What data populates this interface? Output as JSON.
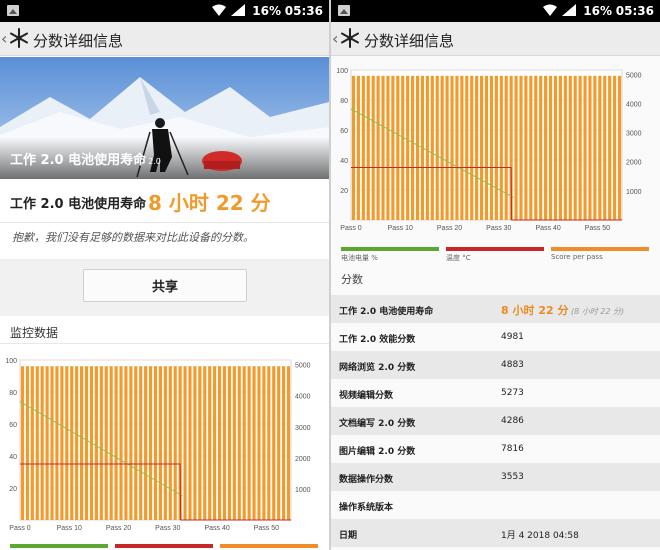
{
  "status": {
    "battery": "16%",
    "time": "05:36"
  },
  "appbar": {
    "title": "分数详细信息",
    "back_icon": "chevron-left-icon",
    "logo_icon": "snowflake-icon"
  },
  "left": {
    "hero_caption": "工作 2.0 电池使用寿命",
    "hero_caption_small": "2.0",
    "score_label": "工作 2.0 电池使用寿命",
    "score_value": "8 小时 22 分",
    "sorry_text": "抱歉，我们没有足够的数据来对比此设备的分数。",
    "share_label": "共享",
    "monitor_label": "监控数据"
  },
  "right": {
    "legend": [
      "电池电量 %",
      "温度 °C",
      "Score per pass"
    ],
    "section_title": "分数",
    "rows": [
      {
        "key": "工作 2.0 电池使用寿命",
        "value": "8 小时 22 分",
        "sub": "(8 小时 22 分)",
        "highlight": true
      },
      {
        "key": "工作 2.0 效能分数",
        "value": "4981"
      },
      {
        "key": "网络浏览 2.0 分数",
        "value": "4883"
      },
      {
        "key": "视频编辑分数",
        "value": "5273"
      },
      {
        "key": "文档编写 2.0 分数",
        "value": "4286"
      },
      {
        "key": "图片编辑 2.0 分数",
        "value": "7816"
      },
      {
        "key": "数据操作分数",
        "value": "3553"
      },
      {
        "key": "操作系统版本",
        "value": ""
      },
      {
        "key": "日期",
        "value": "1月 4 2018 04:58"
      }
    ]
  },
  "chart_data": [
    {
      "type": "bar",
      "series": [
        {
          "name": "Score per pass",
          "axis": "right",
          "values_constant": 4950,
          "count": 55,
          "color": "#f39a2b"
        },
        {
          "name": "电池电量 %",
          "axis": "left",
          "type": "line",
          "x": [
            0,
            33
          ],
          "y": [
            74,
            15
          ],
          "color": "#8bc34a"
        },
        {
          "name": "温度 °C",
          "axis": "left",
          "type": "line",
          "x": [
            0,
            32.5,
            32.6,
            55
          ],
          "y": [
            35,
            35,
            0,
            0
          ],
          "color": "#c62828"
        }
      ],
      "x_ticks": [
        "Pass 0",
        "Pass 10",
        "Pass 20",
        "Pass 30",
        "Pass 40",
        "Pass 50"
      ],
      "y_left_ticks": [
        "100",
        "80",
        "60",
        "40",
        "20"
      ],
      "y_right_ticks": [
        "5000",
        "4000",
        "3000",
        "2000",
        "1000"
      ],
      "ylim_left": [
        0,
        100
      ],
      "ylim_right": [
        0,
        5150
      ],
      "grid": true
    }
  ]
}
